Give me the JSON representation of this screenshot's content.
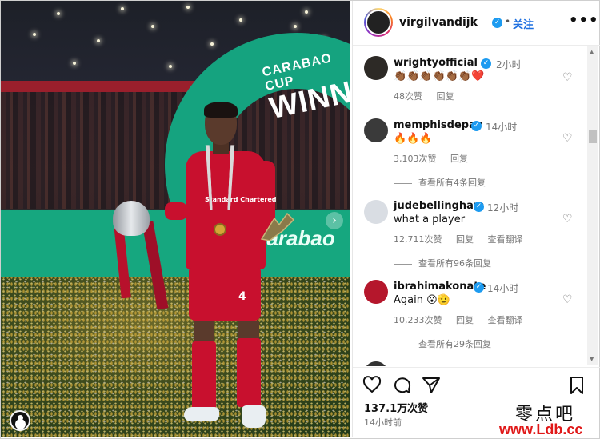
{
  "post": {
    "account": "virgilvandijk",
    "follow_label": "关注",
    "more_label": "•••"
  },
  "photo": {
    "banner_line1": "CARABAO CUP",
    "banner_line2": "WINN",
    "hoarding_text": "carabao",
    "hoarding_arrow": "›",
    "shorts_number": "4",
    "shirt_print": "Standard Chartered"
  },
  "comments": [
    {
      "user": "wrightyofficial",
      "time": "2小时",
      "text": "👏🏾👏🏾👏🏾👏🏾👏🏾👏🏾❤️",
      "likes": "48次赞",
      "reply": "回复",
      "translate": "",
      "view_replies": "",
      "avatar_color": "#2d2a26"
    },
    {
      "user": "memphisdepay",
      "time": "14小时",
      "text": "🔥🔥🔥",
      "likes": "3,103次赞",
      "reply": "回复",
      "translate": "",
      "view_replies": "查看所有4条回复",
      "avatar_color": "#3a3a3a"
    },
    {
      "user": "judebellingham",
      "time": "12小时",
      "text": "what a player",
      "likes": "12,711次赞",
      "reply": "回复",
      "translate": "查看翻译",
      "view_replies": "查看所有96条回复",
      "avatar_color": "#d9dde3"
    },
    {
      "user": "ibrahimakonate",
      "time": "14小时",
      "text": "Again 😮🫡",
      "likes": "10,233次赞",
      "reply": "回复",
      "translate": "查看翻译",
      "view_replies": "查看所有29条回复",
      "avatar_color": "#b5172c"
    }
  ],
  "actions": {
    "like_icon": "heart-icon",
    "comment_icon": "comment-icon",
    "share_icon": "send-icon",
    "save_icon": "bookmark-icon",
    "likes_count": "137.1万次赞",
    "post_time": "14小时前"
  },
  "watermark": {
    "cn": "零点吧",
    "url": "www.Ldb.cc"
  },
  "colors": {
    "accent": "#1d6fe0",
    "verified": "#1d9bf0",
    "liverpool_red": "#c8102e",
    "carabao_green": "#16a77f"
  }
}
